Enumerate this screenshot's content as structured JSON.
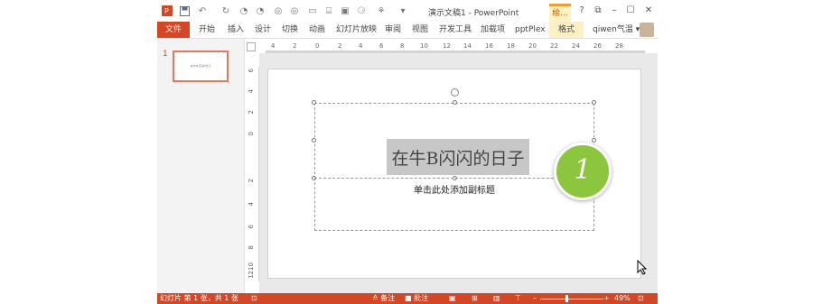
{
  "app": {
    "title": "演示文稿1 - PowerPoint",
    "accent": "#d24726"
  },
  "quick_access": {
    "icons": [
      "powerpoint-logo-icon",
      "save-icon",
      "undo-icon",
      "redo-icon",
      "toolbar-icon",
      "toolbar-icon",
      "toolbar-icon",
      "toolbar-icon",
      "toolbar-icon",
      "toolbar-icon",
      "toolbar-icon",
      "toolbar-icon",
      "customize-icon"
    ]
  },
  "context_tab_top": "绘...",
  "window_controls": {
    "help": "?",
    "restore": "⧉",
    "minimize": "–",
    "maximize": "☐",
    "close": "✕"
  },
  "ribbon": {
    "file_tab": "文件",
    "tabs": [
      "开始",
      "插入",
      "设计",
      "切换",
      "动画",
      "幻灯片放映",
      "审阅",
      "视图",
      "开发工具",
      "加载项",
      "pptPlex"
    ],
    "context_tab": "格式",
    "user": "qiwen气温 ▾"
  },
  "thumbnails": {
    "number": "1",
    "mini_text": "在牛B闪闪的日子"
  },
  "ruler_h": [
    "4",
    "2",
    "0",
    "2",
    "4",
    "6",
    "8",
    "10",
    "12",
    "14",
    "16",
    "18",
    "20",
    "22",
    "24",
    "26",
    "28"
  ],
  "ruler_v": [
    "6",
    "4",
    "2",
    "0",
    "2",
    "4",
    "6",
    "8",
    "10",
    "12"
  ],
  "slide": {
    "title": "在牛B闪闪的日子",
    "subtitle": "单击此处添加副标题"
  },
  "badge": {
    "number": "1",
    "color": "#8cc63e"
  },
  "status_bar": {
    "slide_info": "幻灯片 第 1 张，共 1 张",
    "notes": "≙ 备注",
    "comments": "■ 批注",
    "zoom_minus": "–",
    "zoom_plus": "+",
    "zoom": "49%"
  }
}
